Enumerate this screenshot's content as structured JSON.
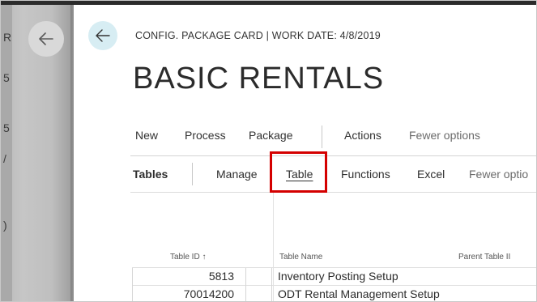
{
  "background_page": {
    "marks": [
      "R",
      "5",
      "5",
      "/",
      ")"
    ]
  },
  "header": {
    "caption": "CONFIG. PACKAGE CARD | WORK DATE: 4/8/2019",
    "title": "BASIC RENTALS"
  },
  "action_bar": {
    "items": [
      "New",
      "Process",
      "Package",
      "Actions",
      "Fewer options"
    ]
  },
  "sub_bar": {
    "label": "Tables",
    "items": [
      "Manage",
      "Table",
      "Functions",
      "Excel",
      "Fewer optio"
    ]
  },
  "table": {
    "columns": [
      "Table ID ↑",
      "Table Name",
      "Parent Table II"
    ],
    "rows": [
      {
        "id": "5813",
        "name": "Inventory Posting Setup"
      },
      {
        "id": "70014200",
        "name": "ODT Rental Management Setup"
      }
    ]
  },
  "colors": {
    "highlight": "#d40000",
    "back_button": "#d7edf3"
  },
  "icons": [
    "back-arrow-icon",
    "sort-ascending-icon"
  ]
}
